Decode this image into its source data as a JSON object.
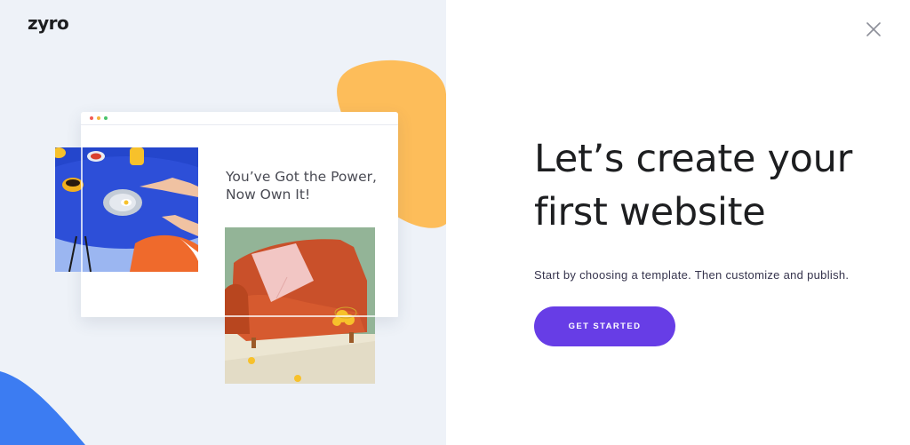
{
  "brand": {
    "logo_text": "zyro"
  },
  "illustration": {
    "preview_headline": "You’ve Got the Power, Now Own It!",
    "browser_dots": [
      "#f25c54",
      "#f5b43b",
      "#49c36b"
    ],
    "accent_yellow": "#fdbd5a",
    "accent_blue": "#3c7cf2",
    "photo_table": "table-photo",
    "photo_sofa": "sofa-photo"
  },
  "main": {
    "title_line1": "Let’s create your",
    "title_line2": "first website",
    "subtitle": "Start by choosing a template. Then customize and publish.",
    "cta_label": "GET STARTED",
    "cta_color": "#673de6"
  },
  "controls": {
    "close_icon": "close-icon"
  }
}
